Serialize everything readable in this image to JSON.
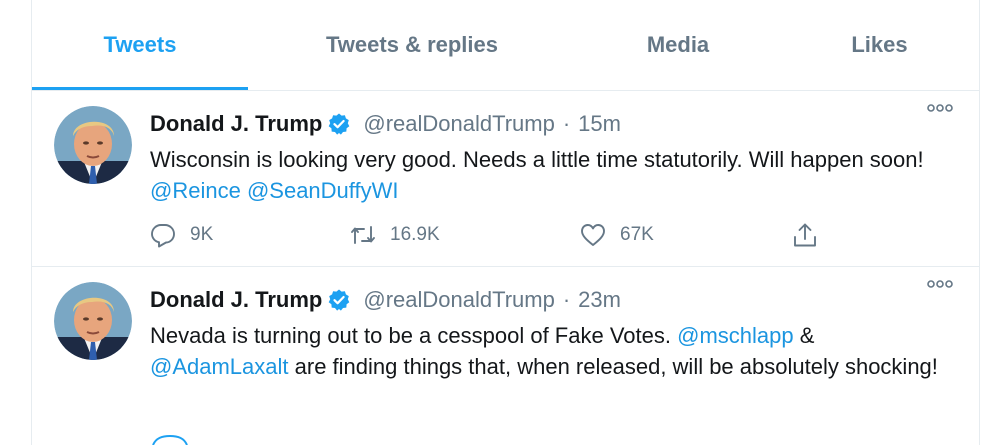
{
  "tabs": [
    {
      "label": "Tweets",
      "active": true
    },
    {
      "label": "Tweets & replies",
      "active": false
    },
    {
      "label": "Media",
      "active": false
    },
    {
      "label": "Likes",
      "active": false
    }
  ],
  "tweets": [
    {
      "name": "Donald J. Trump",
      "handle": "@realDonaldTrump",
      "separator": "·",
      "time": "15m",
      "text_part1": "Wisconsin is looking very good. Needs a little time statutorily. Will happen soon! ",
      "mention1": "@Reince",
      "text_part2": " ",
      "mention2": "@SeanDuffyWI",
      "replies": "9K",
      "retweets": "16.9K",
      "likes": "67K"
    },
    {
      "name": "Donald J. Trump",
      "handle": "@realDonaldTrump",
      "separator": "·",
      "time": "23m",
      "text_part1": "Nevada is turning out to be a cesspool of Fake Votes. ",
      "mention1": "@mschlapp",
      "text_part2": " & ",
      "mention2": "@AdamLaxalt",
      "text_part3": " are finding things that, when released, will be absolutely shocking!"
    }
  ],
  "icons": {
    "verified": "verified-badge-icon",
    "more": "more-options-icon",
    "reply": "reply-icon",
    "retweet": "retweet-icon",
    "like": "like-icon",
    "share": "share-icon"
  },
  "colors": {
    "accent": "#1da1f2",
    "mention": "#1b95e0",
    "secondary_text": "#657786",
    "border": "#e6ecf0"
  }
}
